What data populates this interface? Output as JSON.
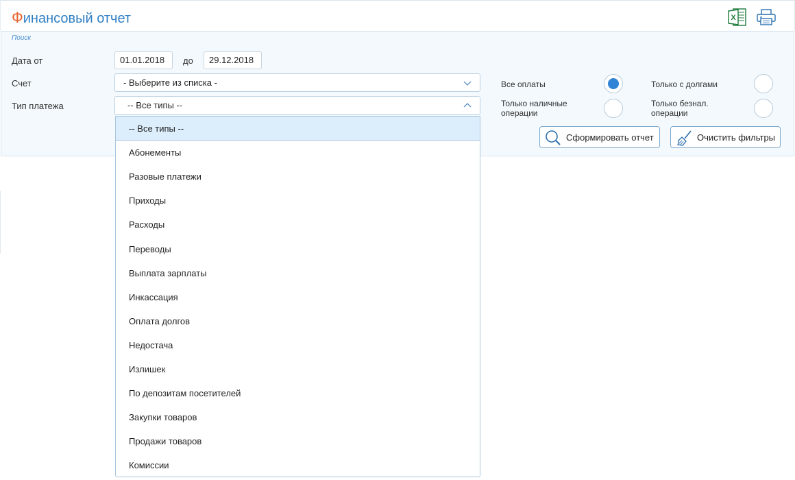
{
  "header": {
    "title_first": "Ф",
    "title_rest": "инансовый отчет",
    "excel_icon": "excel-icon",
    "print_icon": "printer-icon"
  },
  "filters": {
    "caption": "Поиск",
    "date_from_label": "Дата от",
    "date_from_value": "01.01.2018",
    "date_to_label": "до",
    "date_to_value": "29.12.2018",
    "account_label": "Счет",
    "account_value": "- Выберите из списка -",
    "payment_type_label": "Тип платежа",
    "payment_type_value": "-- Все типы --"
  },
  "radios": {
    "all": {
      "label": "Все оплаты",
      "checked": true
    },
    "debts": {
      "label": "Только с долгами",
      "checked": false
    },
    "cash_line1": "Только наличные",
    "cash_line2": "операции",
    "noncash_line1": "Только безнал.",
    "noncash_line2": "операции"
  },
  "buttons": {
    "generate_label": "Сформировать отчет",
    "clear_label": "Очистить фильтры"
  },
  "dropdown": {
    "options": [
      "-- Все типы --",
      "Абонементы",
      "Разовые платежи",
      "Приходы",
      "Расходы",
      "Переводы",
      "Выплата зарплаты",
      "Инкассация",
      "Оплата долгов",
      "Недостача",
      "Излишек",
      "По депозитам посетителей",
      "Закупки товаров",
      "Продажи товаров",
      "Комиссии"
    ],
    "selected_index": 0
  },
  "colors": {
    "accent": "#2f7fc4",
    "title_first_letter": "#e8622a",
    "panel_bg": "#f3f9fd",
    "radio_checked": "#2f84d6"
  }
}
